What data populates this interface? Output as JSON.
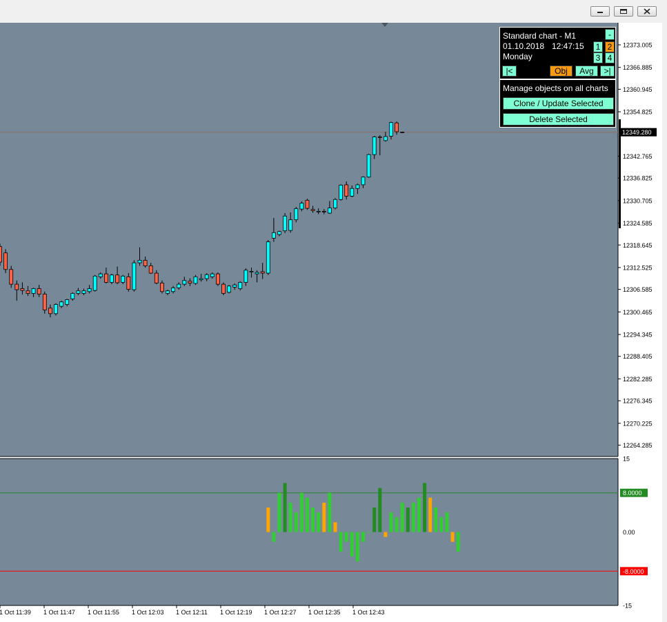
{
  "window": {
    "minimize_icon": "minimize-icon",
    "restore_icon": "restore-icon",
    "close_icon": "close-icon"
  },
  "panel": {
    "title": "Standard chart - M1",
    "date": "01.10.2018",
    "time": "12:47:15",
    "weekday": "Monday",
    "collapse_label": "-",
    "btn_1": "1",
    "btn_2": "2",
    "btn_3": "3",
    "btn_4": "4",
    "first_label": "|<",
    "obj_label": "Obj",
    "avg_label": "Avg",
    "last_label": ">|",
    "manage_text": "Manage objects on all charts",
    "clone_label": "Clone / Update Selected",
    "delete_label": "Delete Selected"
  },
  "colors": {
    "background": "#778899",
    "bull": "#00ffff",
    "bear": "#ff6347",
    "hist_light": "#32cd32",
    "hist_dark": "#228b22",
    "hist_orange": "#ffa500",
    "level_up": "#228b22",
    "level_down": "#ff0000",
    "panel_button": "#7fffd4",
    "panel_button_active": "#f59a12"
  },
  "chart_data": [
    {
      "type": "candlestick",
      "title": "",
      "ylim": [
        12261.2,
        12379.0
      ],
      "y_ticks": [
        "12373.005",
        "12366.885",
        "12360.945",
        "12354.825",
        "12342.765",
        "12336.825",
        "12330.705",
        "12324.585",
        "12318.645",
        "12312.525",
        "12306.585",
        "12300.465",
        "12294.345",
        "12288.405",
        "12282.285",
        "12276.345",
        "12270.225",
        "12264.285"
      ],
      "current_price": "12349.280",
      "x_ticks": [
        "1 Oct 11:39",
        "1 Oct 11:47",
        "1 Oct 11:55",
        "1 Oct 12:03",
        "1 Oct 12:11",
        "1 Oct 12:19",
        "1 Oct 12:27",
        "1 Oct 12:35",
        "1 Oct 12:43"
      ],
      "ohlc": [
        [
          12318.2,
          12319.0,
          12313.0,
          12314.0
        ],
        [
          12316.5,
          12317.5,
          12311.0,
          12312.0
        ],
        [
          12312.0,
          12313.0,
          12307.0,
          12308.0
        ],
        [
          12308.0,
          12309.0,
          12303.5,
          12306.5
        ],
        [
          12306.8,
          12308.5,
          12305.2,
          12306.3
        ],
        [
          12306.2,
          12307.5,
          12304.8,
          12305.5
        ],
        [
          12305.5,
          12307.0,
          12304.5,
          12306.8
        ],
        [
          12306.8,
          12307.8,
          12304.5,
          12305.3
        ],
        [
          12305.3,
          12306.0,
          12300.0,
          12301.0
        ],
        [
          12301.5,
          12302.5,
          12299.0,
          12300.0
        ],
        [
          12300.0,
          12302.8,
          12299.5,
          12302.5
        ],
        [
          12302.0,
          12303.5,
          12301.5,
          12303.2
        ],
        [
          12302.5,
          12304.0,
          12302.0,
          12303.8
        ],
        [
          12304.0,
          12305.8,
          12303.5,
          12305.5
        ],
        [
          12305.5,
          12307.0,
          12305.0,
          12306.2
        ],
        [
          12305.5,
          12306.8,
          12305.0,
          12306.2
        ],
        [
          12306.0,
          12307.8,
          12305.5,
          12306.8
        ],
        [
          12306.3,
          12310.5,
          12306.0,
          12310.2
        ],
        [
          12310.0,
          12311.2,
          12309.5,
          12310.8
        ],
        [
          12310.8,
          12312.5,
          12308.2,
          12308.5
        ],
        [
          12308.5,
          12310.8,
          12308.0,
          12310.5
        ],
        [
          12310.5,
          12312.8,
          12308.0,
          12308.4
        ],
        [
          12308.5,
          12310.5,
          12308.0,
          12310.2
        ],
        [
          12310.0,
          12311.0,
          12306.0,
          12306.6
        ],
        [
          12306.5,
          12314.5,
          12306.0,
          12313.8
        ],
        [
          12313.8,
          12318.0,
          12313.0,
          12314.5
        ],
        [
          12314.5,
          12315.5,
          12312.5,
          12313.0
        ],
        [
          12313.0,
          12313.8,
          12310.8,
          12311.0
        ],
        [
          12311.0,
          12311.8,
          12308.0,
          12308.3
        ],
        [
          12308.3,
          12309.0,
          12305.5,
          12306.0
        ],
        [
          12305.5,
          12306.5,
          12305.0,
          12306.2
        ],
        [
          12306.0,
          12307.5,
          12305.5,
          12307.0
        ],
        [
          12307.0,
          12308.5,
          12306.5,
          12308.0
        ],
        [
          12308.0,
          12310.0,
          12307.5,
          12309.0
        ],
        [
          12308.8,
          12309.6,
          12307.5,
          12308.3
        ],
        [
          12308.2,
          12310.5,
          12307.8,
          12310.0
        ],
        [
          12309.2,
          12310.8,
          12308.7,
          12309.5
        ],
        [
          12309.5,
          12311.0,
          12308.8,
          12310.6
        ],
        [
          12310.0,
          12311.2,
          12309.5,
          12310.8
        ],
        [
          12310.8,
          12311.2,
          12307.5,
          12308.0
        ],
        [
          12308.0,
          12308.5,
          12305.0,
          12305.5
        ],
        [
          12305.8,
          12307.8,
          12305.5,
          12307.5
        ],
        [
          12307.2,
          12308.2,
          12306.5,
          12307.8
        ],
        [
          12306.8,
          12308.8,
          12306.3,
          12308.5
        ],
        [
          12308.5,
          12312.3,
          12307.5,
          12311.8
        ],
        [
          12311.3,
          12312.5,
          12309.8,
          12311.5
        ],
        [
          12310.8,
          12311.8,
          12308.5,
          12311.2
        ],
        [
          12311.4,
          12313.8,
          12309.4,
          12311.0
        ],
        [
          12311.0,
          12320.0,
          12310.5,
          12319.5
        ],
        [
          12320.5,
          12326.0,
          12319.5,
          12322.0
        ],
        [
          12321.5,
          12322.5,
          12321.0,
          12322.3
        ],
        [
          12322.5,
          12327.3,
          12321.9,
          12326.5
        ],
        [
          12322.6,
          12327.5,
          12322.0,
          12325.5
        ],
        [
          12325.5,
          12329.0,
          12324.8,
          12328.5
        ],
        [
          12328.4,
          12330.5,
          12327.8,
          12330.0
        ],
        [
          12330.8,
          12331.2,
          12328.2,
          12328.6
        ],
        [
          12328.3,
          12329.3,
          12327.4,
          12328.0
        ],
        [
          12327.8,
          12328.6,
          12327.0,
          12327.8
        ],
        [
          12327.8,
          12328.4,
          12327.0,
          12327.6
        ],
        [
          12327.3,
          12330.6,
          12327.1,
          12328.7
        ],
        [
          12328.7,
          12331.4,
          12328.3,
          12331.0
        ],
        [
          12331.0,
          12335.1,
          12330.7,
          12334.9
        ],
        [
          12335.0,
          12335.9,
          12331.0,
          12331.9
        ],
        [
          12331.9,
          12334.8,
          12331.6,
          12334.0
        ],
        [
          12334.0,
          12335.3,
          12332.5,
          12335.0
        ],
        [
          12335.0,
          12337.3,
          12334.1,
          12337.1
        ],
        [
          12337.1,
          12343.4,
          12336.9,
          12343.2
        ],
        [
          12343.2,
          12348.3,
          12342.0,
          12348.0
        ],
        [
          12348.0,
          12348.5,
          12343.0,
          12347.8
        ],
        [
          12347.0,
          12349.4,
          12346.7,
          12348.1
        ],
        [
          12348.2,
          12352.1,
          12347.3,
          12351.9
        ],
        [
          12351.8,
          12352.2,
          12348.6,
          12349.4
        ],
        [
          12349.3,
          12349.4,
          12349.0,
          12349.2
        ]
      ]
    },
    {
      "type": "bar",
      "title": "",
      "ylim": [
        -15,
        15
      ],
      "y_ticks": [
        "15",
        "0.00",
        "-15"
      ],
      "levels": [
        "8.0000",
        "-8.0000"
      ],
      "start_index": 48,
      "values": [
        5,
        -2,
        8,
        10,
        6,
        4,
        8,
        7,
        5,
        4,
        6,
        8,
        2,
        -4,
        -2,
        -5,
        -6,
        -2,
        0,
        5,
        9,
        -1,
        4,
        3,
        6,
        5,
        6,
        7,
        10,
        7,
        5,
        3,
        4,
        -2,
        -4
      ],
      "color_keys": [
        "hist_orange",
        "hist_light",
        "hist_light",
        "hist_dark",
        "hist_light",
        "hist_light",
        "hist_light",
        "hist_light",
        "hist_light",
        "hist_light",
        "hist_orange",
        "hist_light",
        "hist_orange",
        "hist_light",
        "hist_light",
        "hist_light",
        "hist_light",
        "hist_light",
        "hist_light",
        "hist_dark",
        "hist_dark",
        "hist_orange",
        "hist_light",
        "hist_light",
        "hist_light",
        "hist_dark",
        "hist_light",
        "hist_light",
        "hist_dark",
        "hist_orange",
        "hist_light",
        "hist_light",
        "hist_light",
        "hist_orange",
        "hist_light"
      ]
    }
  ]
}
